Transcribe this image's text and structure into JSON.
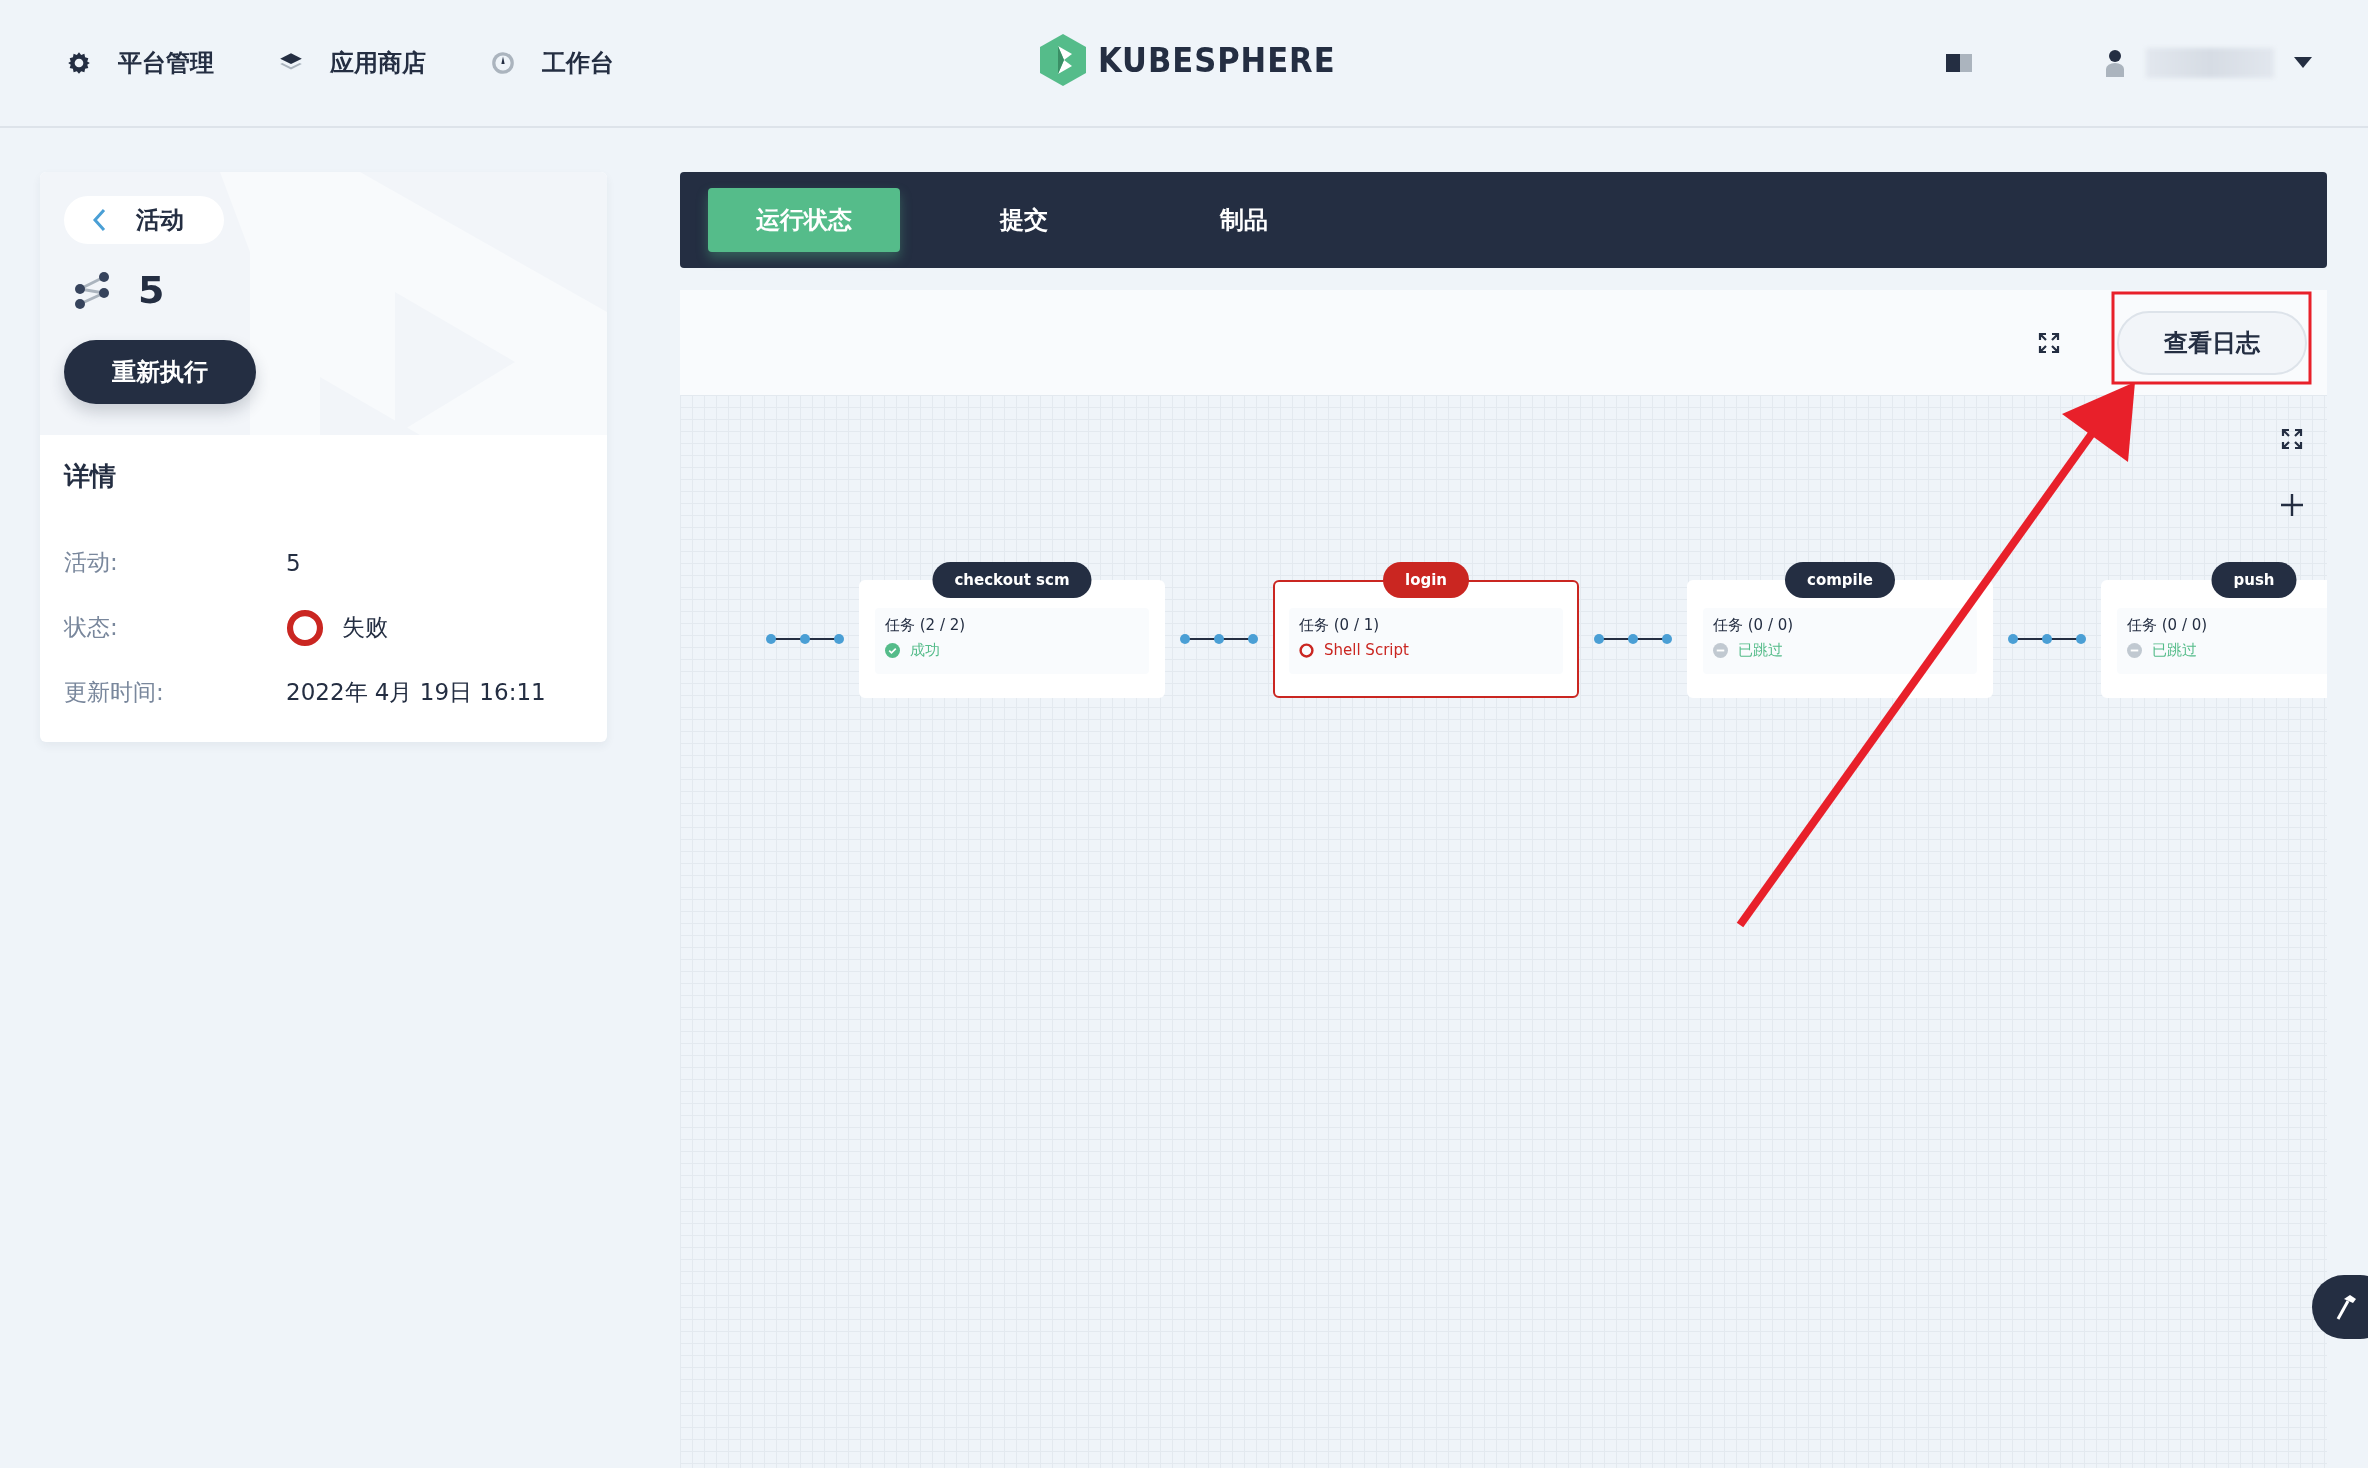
{
  "nav": [
    {
      "label": "平台管理",
      "kind": "gear"
    },
    {
      "label": "应用商店",
      "kind": "layers"
    },
    {
      "label": "工作台",
      "kind": "dial"
    }
  ],
  "logo": {
    "text": "KUBESPHERE"
  },
  "run": {
    "back_label": "活动",
    "number": "5",
    "rerun_button": "重新执行"
  },
  "details": {
    "title": "详情",
    "rows": [
      {
        "label": "活动:",
        "value": "5",
        "kind": "text"
      },
      {
        "label": "状态:",
        "value": "失败",
        "kind": "failed"
      },
      {
        "label": "更新时间:",
        "value": "2022年 4月 19日 16:11",
        "kind": "text"
      }
    ]
  },
  "tabs": [
    {
      "label": "运行状态",
      "selected": true
    },
    {
      "label": "提交",
      "selected": false
    },
    {
      "label": "制品",
      "selected": false
    }
  ],
  "toolbar": {
    "view_log_button": "查看日志"
  },
  "stages": [
    {
      "name": "checkout scm",
      "kind": "success",
      "tasks": "任务 (2 / 2)",
      "step": "成功"
    },
    {
      "name": "login",
      "kind": "failed",
      "tasks": "任务 (0 / 1)",
      "step": "Shell Script"
    },
    {
      "name": "compile",
      "kind": "skipped",
      "tasks": "任务 (0 / 0)",
      "step": "已跳过"
    },
    {
      "name": "push",
      "kind": "skipped",
      "tasks": "任务 (0 / 0)",
      "step": "已跳过"
    }
  ]
}
